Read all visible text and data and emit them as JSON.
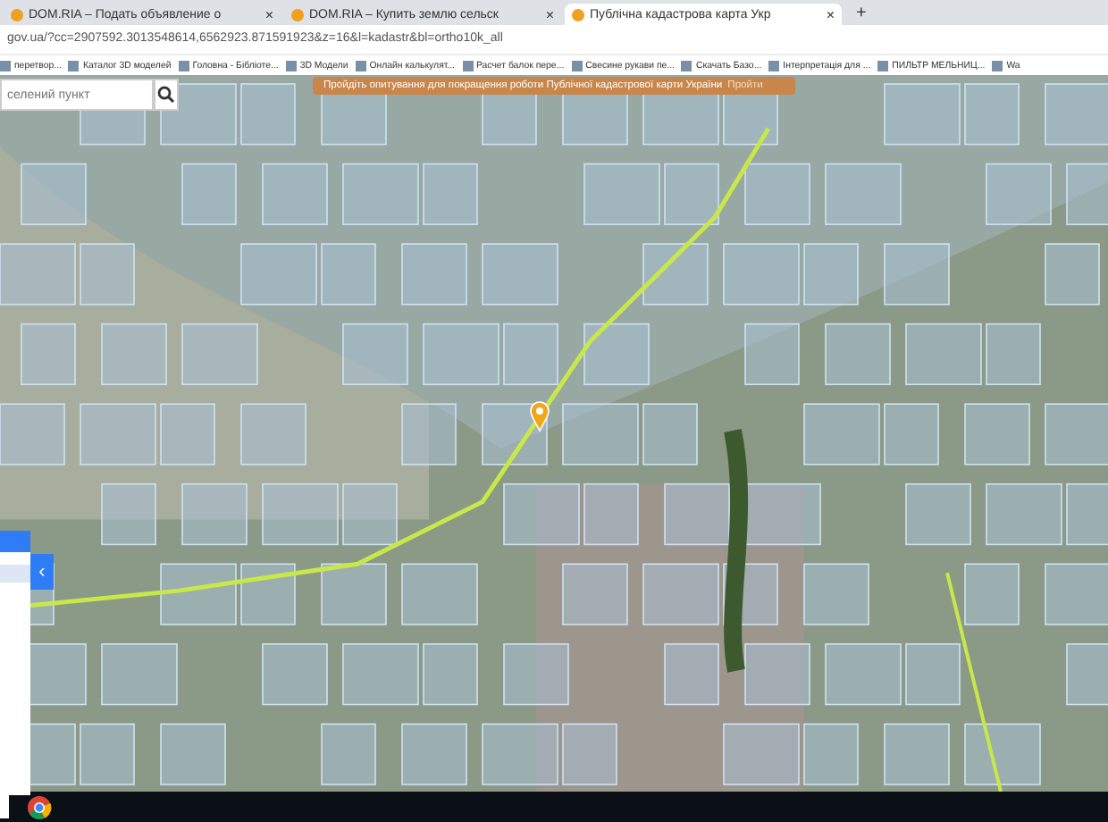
{
  "tabs": [
    {
      "title": "DOM.RIA – Подать объявление о",
      "close": "×",
      "selected": false
    },
    {
      "title": "DOM.RIA – Купить землю сельск",
      "close": "×",
      "selected": false
    },
    {
      "title": "Публічна кадастрова карта Укр",
      "close": "×",
      "selected": true
    }
  ],
  "new_tab": "+",
  "address": "gov.ua/?cc=2907592.3013548614,6562923.871591923&z=16&l=kadastr&bl=ortho10k_all",
  "bookmarks": [
    "перетвор...",
    "Каталог 3D моделей",
    "Головна - Бібліоте...",
    "3D Модели",
    "Онлайн калькулят...",
    "Расчет балок пере...",
    "Свесине рукави пе...",
    "Скачать Базо...",
    "Інтерпретація для ...",
    "ПИЛЬТР МЕЛЬНИЦ...",
    "Wa"
  ],
  "map": {
    "search": {
      "placeholder": "селений пункт"
    },
    "banner": {
      "text": "Пройдіть опитування для покращення роботи Публічної кадастрової карти України",
      "link": "Пройти"
    },
    "panel_toggle": "‹"
  }
}
